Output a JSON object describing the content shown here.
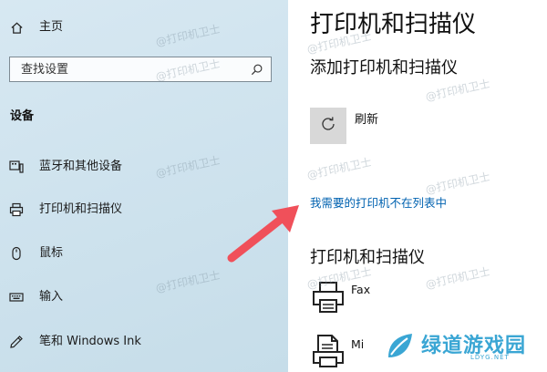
{
  "sidebar": {
    "home_label": "主页",
    "search_placeholder": "查找设置",
    "section_heading": "设备",
    "items": [
      {
        "label": "蓝牙和其他设备",
        "icon": "bluetooth-devices-icon"
      },
      {
        "label": "打印机和扫描仪",
        "icon": "printer-icon"
      },
      {
        "label": "鼠标",
        "icon": "mouse-icon"
      },
      {
        "label": "输入",
        "icon": "keyboard-icon"
      },
      {
        "label": "笔和 Windows Ink",
        "icon": "pen-icon"
      }
    ]
  },
  "main": {
    "title": "打印机和扫描仪",
    "add_heading": "添加打印机和扫描仪",
    "refresh_label": "刷新",
    "missing_printer_link": "我需要的打印机不在列表中",
    "list_heading": "打印机和扫描仪",
    "devices": [
      {
        "name": "Fax",
        "icon": "fax-printer-icon"
      },
      {
        "name": "Mi",
        "icon": "document-printer-icon"
      }
    ]
  },
  "watermark_text": "@打印机卫士",
  "logo": {
    "name": "绿道游戏园",
    "sub": "LDYG.NET"
  },
  "colors": {
    "accent_link": "#0062b0",
    "annotation_arrow": "#f0505a",
    "logo": "#3aa6d4"
  }
}
